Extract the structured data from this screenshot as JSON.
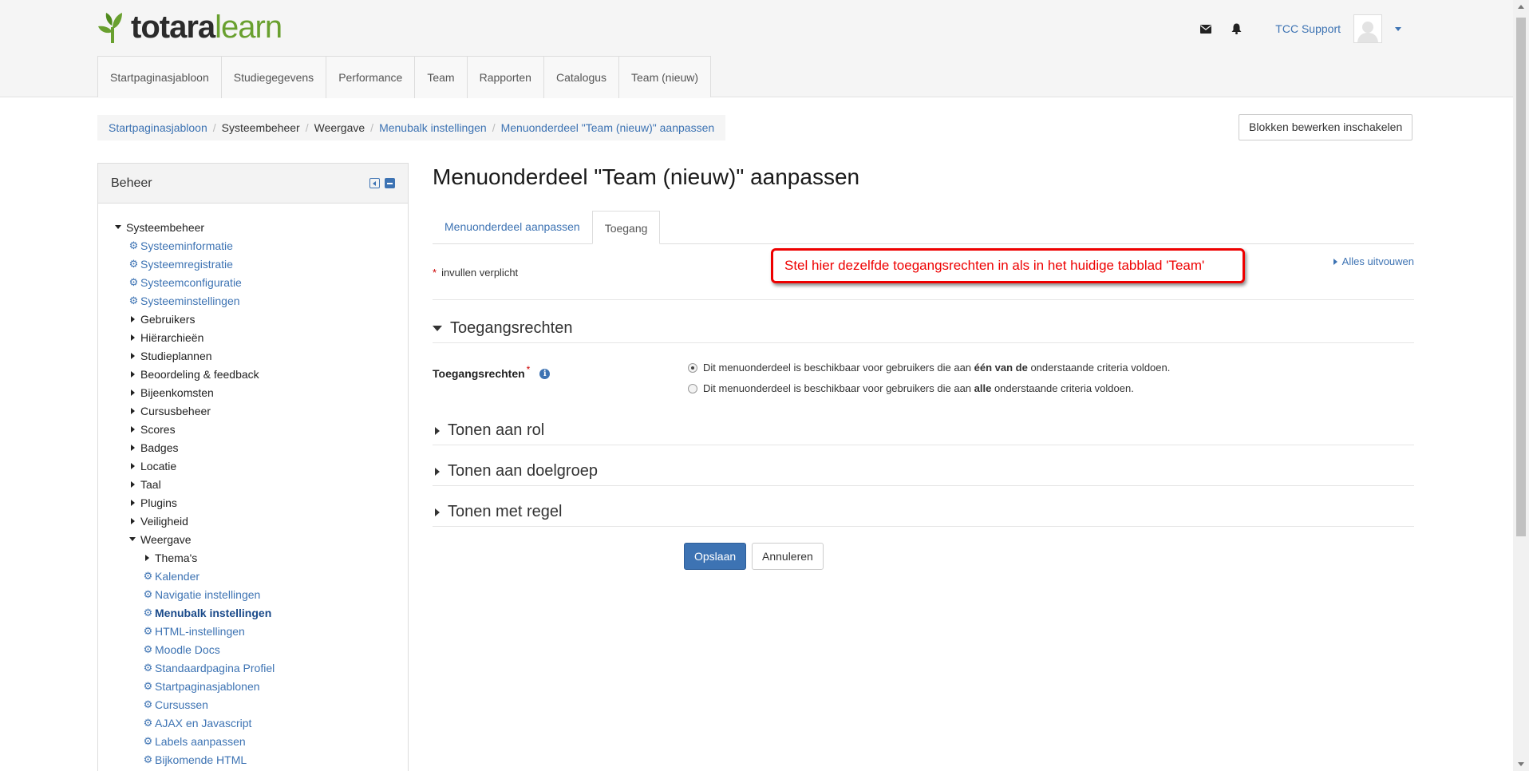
{
  "header": {
    "logo_left": "totara",
    "logo_right": "learn",
    "user_name": "TCC Support"
  },
  "nav": {
    "items": [
      "Startpaginasjabloon",
      "Studiegegevens",
      "Performance",
      "Team",
      "Rapporten",
      "Catalogus",
      "Team (nieuw)"
    ]
  },
  "breadcrumb": {
    "items": [
      {
        "label": "Startpaginasjabloon",
        "link": true
      },
      {
        "label": "Systeembeheer",
        "link": false
      },
      {
        "label": "Weergave",
        "link": false
      },
      {
        "label": "Menubalk instellingen",
        "link": true
      },
      {
        "label": "Menuonderdeel \"Team (nieuw)\" aanpassen",
        "link": true
      }
    ],
    "edit_blocks_label": "Blokken bewerken inschakelen"
  },
  "sidebar": {
    "title": "Beheer",
    "items": [
      {
        "label": "Systeembeheer",
        "level": 1,
        "kind": "open"
      },
      {
        "label": "Systeeminformatie",
        "level": 2,
        "kind": "gear"
      },
      {
        "label": "Systeemregistratie",
        "level": 2,
        "kind": "gear"
      },
      {
        "label": "Systeemconfiguratie",
        "level": 2,
        "kind": "gear"
      },
      {
        "label": "Systeeminstellingen",
        "level": 2,
        "kind": "gear"
      },
      {
        "label": "Gebruikers",
        "level": 2,
        "kind": "closed"
      },
      {
        "label": "Hiërarchieën",
        "level": 2,
        "kind": "closed"
      },
      {
        "label": "Studieplannen",
        "level": 2,
        "kind": "closed"
      },
      {
        "label": "Beoordeling & feedback",
        "level": 2,
        "kind": "closed"
      },
      {
        "label": "Bijeenkomsten",
        "level": 2,
        "kind": "closed"
      },
      {
        "label": "Cursusbeheer",
        "level": 2,
        "kind": "closed"
      },
      {
        "label": "Scores",
        "level": 2,
        "kind": "closed"
      },
      {
        "label": "Badges",
        "level": 2,
        "kind": "closed"
      },
      {
        "label": "Locatie",
        "level": 2,
        "kind": "closed"
      },
      {
        "label": "Taal",
        "level": 2,
        "kind": "closed"
      },
      {
        "label": "Plugins",
        "level": 2,
        "kind": "closed"
      },
      {
        "label": "Veiligheid",
        "level": 2,
        "kind": "closed"
      },
      {
        "label": "Weergave",
        "level": 2,
        "kind": "open"
      },
      {
        "label": "Thema's",
        "level": 3,
        "kind": "closed"
      },
      {
        "label": "Kalender",
        "level": 3,
        "kind": "gear"
      },
      {
        "label": "Navigatie instellingen",
        "level": 3,
        "kind": "gear"
      },
      {
        "label": "Menubalk instellingen",
        "level": 3,
        "kind": "gear-active"
      },
      {
        "label": "HTML-instellingen",
        "level": 3,
        "kind": "gear"
      },
      {
        "label": "Moodle Docs",
        "level": 3,
        "kind": "gear"
      },
      {
        "label": "Standaardpagina Profiel",
        "level": 3,
        "kind": "gear"
      },
      {
        "label": "Startpaginasjablonen",
        "level": 3,
        "kind": "gear"
      },
      {
        "label": "Cursussen",
        "level": 3,
        "kind": "gear"
      },
      {
        "label": "AJAX en Javascript",
        "level": 3,
        "kind": "gear"
      },
      {
        "label": "Labels aanpassen",
        "level": 3,
        "kind": "gear"
      },
      {
        "label": "Bijkomende HTML",
        "level": 3,
        "kind": "gear"
      }
    ]
  },
  "main": {
    "title": "Menuonderdeel \"Team (nieuw)\" aanpassen",
    "tabs": [
      {
        "label": "Menuonderdeel aanpassen",
        "active": false
      },
      {
        "label": "Toegang",
        "active": true
      }
    ],
    "required_note": "invullen verplicht",
    "required_star": "*",
    "expand_all": "Alles uitvouwen",
    "callout": "Stel hier dezelfde toegangsrechten in als in het huidige tabblad 'Team'",
    "section_access": "Toegangsrechten",
    "access_label": "Toegangsrechten",
    "option1_pre": "Dit menuonderdeel is beschikbaar voor gebruikers die aan ",
    "option1_bold": "één van de",
    "option1_post": " onderstaande criteria voldoen.",
    "option2_pre": "Dit menuonderdeel is beschikbaar voor gebruikers die aan ",
    "option2_bold": "alle",
    "option2_post": " onderstaande criteria voldoen.",
    "section_role": "Tonen aan rol",
    "section_audience": "Tonen aan doelgroep",
    "section_rule": "Tonen met regel",
    "save": "Opslaan",
    "cancel": "Annuleren"
  }
}
